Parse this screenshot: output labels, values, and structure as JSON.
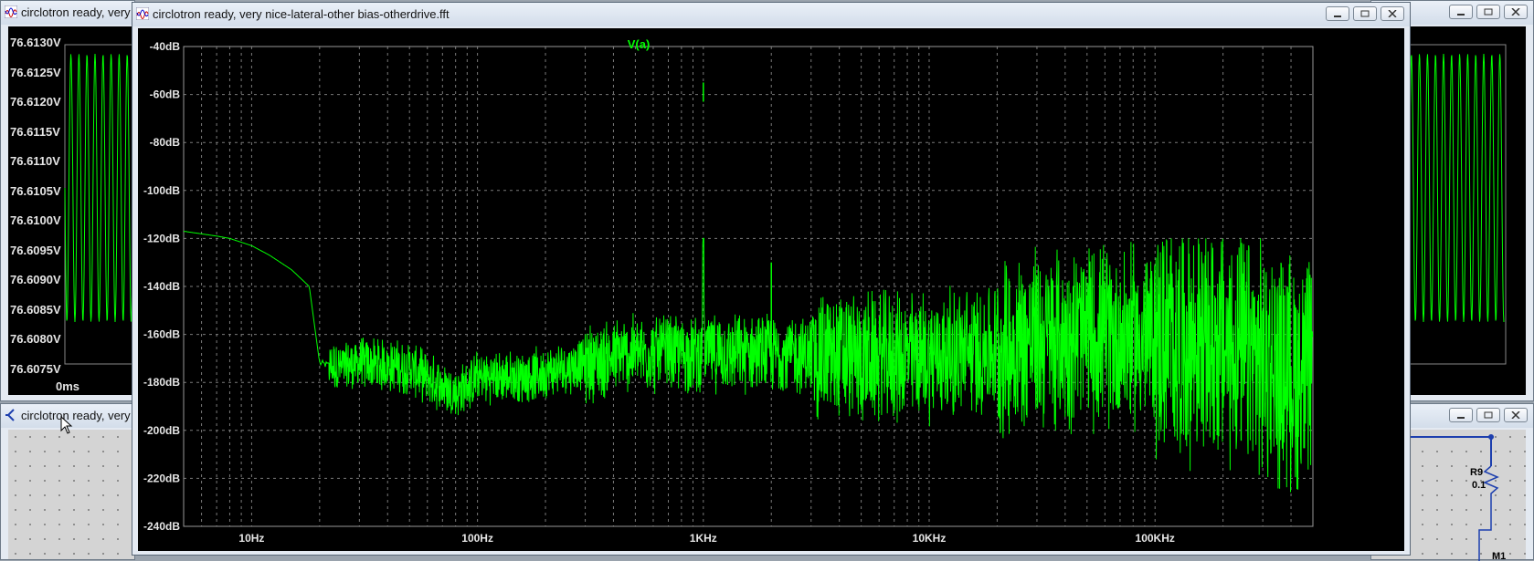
{
  "windows": {
    "left_waveform": {
      "title": "circlotron ready, very"
    },
    "left_schematic": {
      "title": "circlotron ready, very"
    },
    "main_fft": {
      "title": "circlotron ready, very nice-lateral-other bias-otherdrive.fft"
    }
  },
  "left_plot": {
    "y_ticks": [
      "76.6130V",
      "76.6125V",
      "76.6120V",
      "76.6115V",
      "76.6110V",
      "76.6105V",
      "76.6100V",
      "76.6095V",
      "76.6090V",
      "76.6085V",
      "76.6080V",
      "76.6075V"
    ],
    "x_tick": "0ms"
  },
  "schematic": {
    "component_name": "R9",
    "component_value": "0.1",
    "component_partial": "M1"
  },
  "chart_data": {
    "type": "line",
    "title": "V(a)",
    "series_color": "#00ff00",
    "xscale": "log",
    "xlim": [
      5,
      500000
    ],
    "ylim": [
      -240,
      -40
    ],
    "y_ticks": [
      "-40dB",
      "-60dB",
      "-80dB",
      "-100dB",
      "-120dB",
      "-140dB",
      "-160dB",
      "-180dB",
      "-200dB",
      "-220dB",
      "-240dB"
    ],
    "x_ticks": [
      "10Hz",
      "100Hz",
      "1KHz",
      "10KHz",
      "100KHz"
    ],
    "grid": true,
    "series": [
      {
        "color": "#00ff00",
        "x": [
          5,
          7,
          8,
          10,
          12,
          15,
          18,
          20,
          25,
          30,
          40,
          50,
          60,
          80,
          100,
          150,
          200,
          300,
          500,
          700,
          990,
          1000,
          1010,
          2000,
          5000,
          10000,
          20000,
          30000,
          50000,
          100000,
          200000,
          300000,
          500000
        ],
        "y": [
          -117,
          -119,
          -120,
          -123,
          -127,
          -133,
          -140,
          -172,
          -174,
          -172,
          -173,
          -174,
          -178,
          -185,
          -178,
          -178,
          -176,
          -172,
          -168,
          -168,
          -168,
          -55,
          -168,
          -168,
          -170,
          -169,
          -166,
          -162,
          -160,
          -162,
          -165,
          -172,
          -178
        ]
      }
    ],
    "peaks": [
      {
        "x": 1000,
        "y": -55
      },
      {
        "x": 2000,
        "y": -130
      }
    ]
  }
}
